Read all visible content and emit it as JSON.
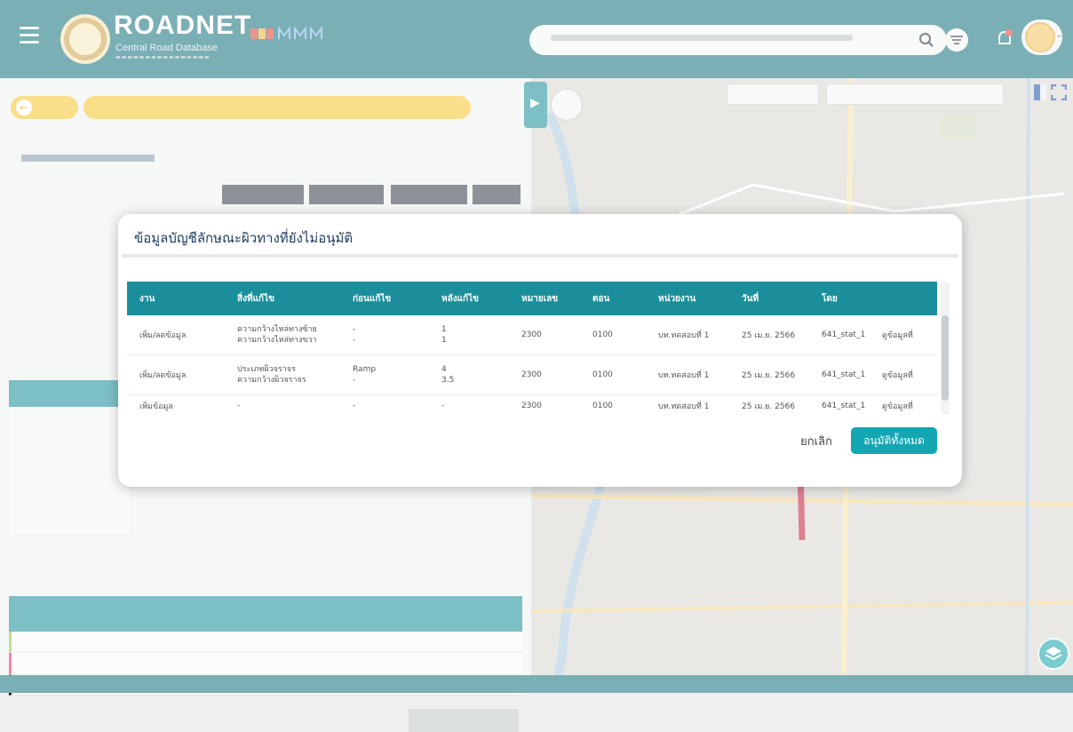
{
  "brand": {
    "name": "ROADNET",
    "subtitle": "Central Road Database"
  },
  "modal": {
    "title": "ข้อมูลบัญชีลักษณะผิวทางที่ยังไม่อนุมัติ",
    "cancel_label": "ยกเลิก",
    "approve_all_label": "อนุมัติทั้งหมด",
    "columns": [
      "งาน",
      "สิ่งที่แก้ไข",
      "ก่อนแก้ไข",
      "หลังแก้ไข",
      "หมายเลข",
      "ตอน",
      "หน่วยงาน",
      "วันที่",
      "โดย",
      ""
    ],
    "rows": [
      {
        "work": "เพิ่ม/ลดข้อมูล",
        "changed": [
          "ความกว้างไหล่ทางซ้าย",
          "ความกว้างไหล่ทางขวา"
        ],
        "before": [
          "-",
          "-"
        ],
        "after": [
          "1",
          "1"
        ],
        "route": "2300",
        "section": "0100",
        "unit": "บท.ทดสอบที่ 1",
        "date": "25 เม.ย. 2566",
        "by": "641_stat_1",
        "detail": "ดูข้อมูลที่"
      },
      {
        "work": "เพิ่ม/ลดข้อมูล",
        "changed": [
          "ประเภทผิวจราจร",
          "ความกว้างผิวจราจร"
        ],
        "before": [
          "Ramp",
          "-"
        ],
        "after": [
          "4",
          "3.5"
        ],
        "route": "2300",
        "section": "0100",
        "unit": "บท.ทดสอบที่ 1",
        "date": "25 เม.ย. 2566",
        "by": "641_stat_1",
        "detail": "ดูข้อมูลที่"
      },
      {
        "work": "เพิ่มข้อมูล",
        "changed": [
          "-"
        ],
        "before": [
          "-"
        ],
        "after": [
          "-"
        ],
        "route": "2300",
        "section": "0100",
        "unit": "บท.ทดสอบที่ 1",
        "date": "25 เม.ย. 2566",
        "by": "641_stat_1",
        "detail": "ดูข้อมูลที่"
      }
    ]
  }
}
